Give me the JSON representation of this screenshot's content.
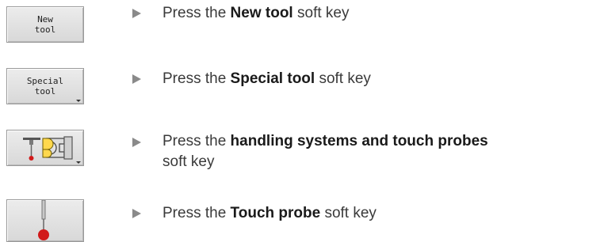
{
  "steps": [
    {
      "softkey_label": "New\ntool",
      "prefix": "Press the ",
      "bold": "New tool",
      "suffix": " soft key"
    },
    {
      "softkey_label": "Special\ntool",
      "prefix": "Press the ",
      "bold": "Special tool",
      "suffix": " soft key"
    },
    {
      "softkey_icon": "handling-systems-and-touch-probes-icon",
      "prefix": "Press the ",
      "bold": "handling systems and touch probes",
      "suffix": "soft key"
    },
    {
      "softkey_icon": "touch-probe-icon",
      "prefix": "Press the ",
      "bold": "Touch probe",
      "suffix": " soft key"
    }
  ],
  "colors": {
    "bullet": "#8a8a8a",
    "text": "#3a3a3a",
    "probe_tip": "#d11a1a"
  }
}
